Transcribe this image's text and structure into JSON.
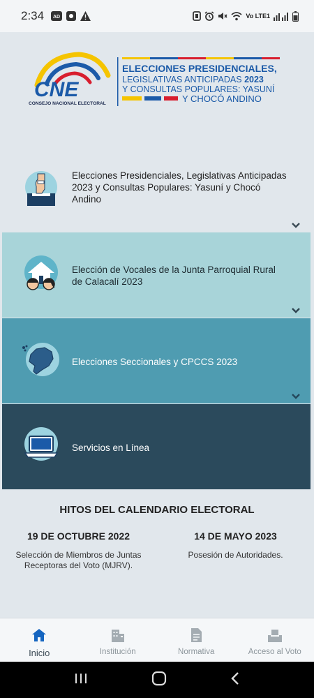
{
  "status_bar": {
    "time": "2:34",
    "left_icons": [
      "ad-icon",
      "app-icon",
      "warning-icon"
    ],
    "right_icons": [
      "nfc-icon",
      "alarm-icon",
      "mute-icon",
      "wifi-icon",
      "signal-icon",
      "battery-icon"
    ],
    "lte_text": "Vo LTE1"
  },
  "banner": {
    "logo_text": "CNE",
    "org_name": "CONSEJO NACIONAL ELECTORAL",
    "line1": "ELECCIONES PRESIDENCIALES,",
    "line2_a": "LEGISLATIVAS ANTICIPADAS ",
    "line2_b": "2023",
    "line3": "Y CONSULTAS POPULARES: YASUNÍ",
    "line4": "Y CHOCÓ ANDINO",
    "colors": {
      "blue": "#1b5aa8",
      "yellow": "#f5c400",
      "red": "#d81e2e",
      "dark": "#1d2b4f"
    }
  },
  "elections": [
    {
      "label": "Elecciones Presidenciales, Legislativas Anticipadas 2023 y Consultas Populares: Yasuní y Chocó Andino",
      "icon": "ballot-box-icon",
      "has_chevron": true
    },
    {
      "label": "Elección de Vocales de la Junta Parroquial Rural de Calacalí 2023",
      "icon": "community-icon",
      "has_chevron": true
    },
    {
      "label": "Elecciones Seccionales y CPCCS 2023",
      "icon": "ecuador-map-icon",
      "has_chevron": true
    },
    {
      "label": "Servicios en Línea",
      "icon": "laptop-icon",
      "has_chevron": false
    }
  ],
  "hitos": {
    "title": "HITOS DEL CALENDARIO ELECTORAL",
    "items": [
      {
        "date": "19 DE OCTUBRE 2022",
        "description": "Selección de Miembros de Juntas Receptoras del Voto (MJRV)."
      },
      {
        "date": "14 DE MAYO 2023",
        "description": "Posesión de Autoridades."
      }
    ]
  },
  "nav": {
    "items": [
      {
        "label": "Inicio",
        "icon": "home-icon",
        "active": true
      },
      {
        "label": "Institución",
        "icon": "building-icon",
        "active": false
      },
      {
        "label": "Normativa",
        "icon": "document-icon",
        "active": false
      },
      {
        "label": "Acceso al Voto",
        "icon": "ballot-icon",
        "active": false
      }
    ],
    "active_color": "#1565c0",
    "inactive_color": "#a4acb2"
  }
}
